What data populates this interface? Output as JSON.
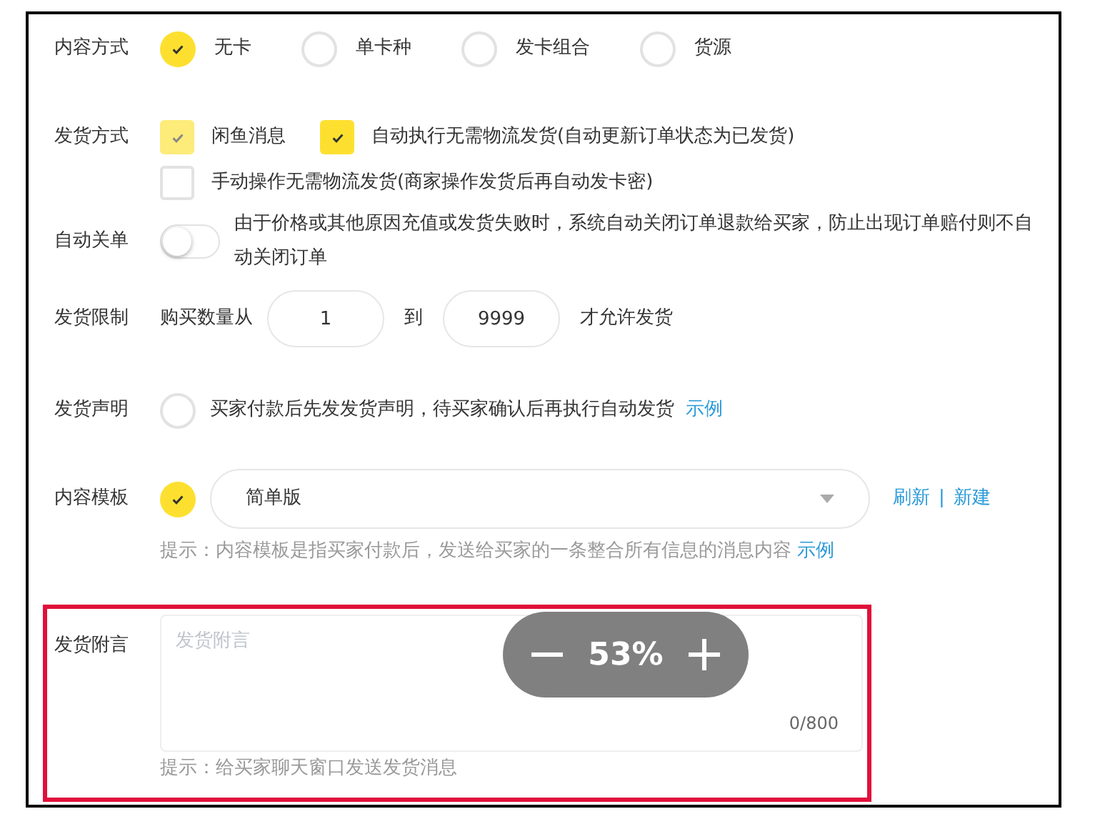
{
  "content_mode": {
    "label": "内容方式",
    "options": [
      {
        "label": "无卡",
        "selected": true
      },
      {
        "label": "单卡种",
        "selected": false
      },
      {
        "label": "发卡组合",
        "selected": false
      },
      {
        "label": "货源",
        "selected": false
      }
    ]
  },
  "shipping_method": {
    "label": "发货方式",
    "options": [
      {
        "label": "闲鱼消息",
        "checked": true,
        "disabled": true
      },
      {
        "label": "自动执行无需物流发货(自动更新订单状态为已发货)",
        "checked": true,
        "disabled": false
      },
      {
        "label": "手动操作无需物流发货(商家操作发货后再自动发卡密)",
        "checked": false,
        "disabled": false
      }
    ]
  },
  "auto_close": {
    "label": "自动关单",
    "on": false,
    "description": "由于价格或其他原因充值或发货失败时，系统自动关闭订单退款给买家，防止出现订单赔付则不自动关闭订单"
  },
  "shipping_limit": {
    "label": "发货限制",
    "prefix": "购买数量从",
    "min": "1",
    "to": "到",
    "max": "9999",
    "suffix": "才允许发货"
  },
  "shipping_statement": {
    "label": "发货声明",
    "checked": false,
    "text": "买家付款后先发发货声明，待买家确认后再执行自动发货",
    "link": "示例"
  },
  "content_template": {
    "label": "内容模板",
    "checked": true,
    "value": "简单版",
    "links": [
      "刷新",
      "新建"
    ],
    "separator": "|",
    "hint": "提示：内容模板是指买家付款后，发送给买家的一条整合所有信息的消息内容",
    "hint_link": "示例"
  },
  "shipping_note": {
    "label": "发货附言",
    "placeholder": "发货附言",
    "counter": "0/800",
    "hint": "提示：给买家聊天窗口发送发货消息"
  },
  "zoom_overlay": {
    "value": "53%"
  }
}
